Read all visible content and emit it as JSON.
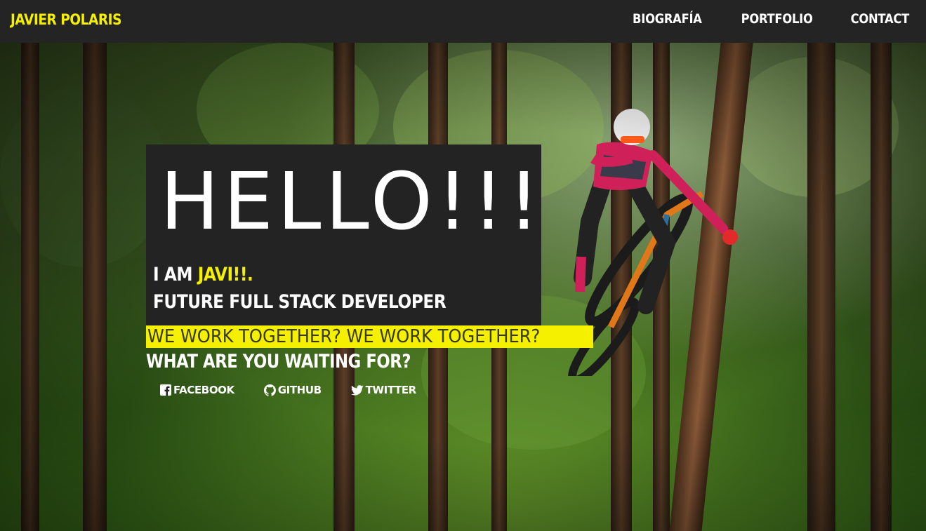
{
  "header": {
    "brand": "JAVIER POLARIS",
    "nav": [
      {
        "label": "BIOGRAFÍA"
      },
      {
        "label": "PORTFOLIO"
      },
      {
        "label": "CONTACT"
      }
    ]
  },
  "hero": {
    "greeting": "HELLO!!!",
    "intro_prefix": "I AM",
    "intro_name": "JAVI!!.",
    "role": "FUTURE FULL STACK DEVELOPER",
    "marquee": "WE WORK TOGETHER? WE WORK TOGETHER?",
    "cta": "WHAT ARE YOU WAITING FOR?",
    "social": [
      {
        "label": "FACEBOOK",
        "icon": "facebook-icon"
      },
      {
        "label": "GITHUB",
        "icon": "github-icon"
      },
      {
        "label": "TWITTER",
        "icon": "twitter-icon"
      }
    ]
  },
  "colors": {
    "accent": "#f4f000",
    "bar": "#242424",
    "panel": "#232323"
  }
}
